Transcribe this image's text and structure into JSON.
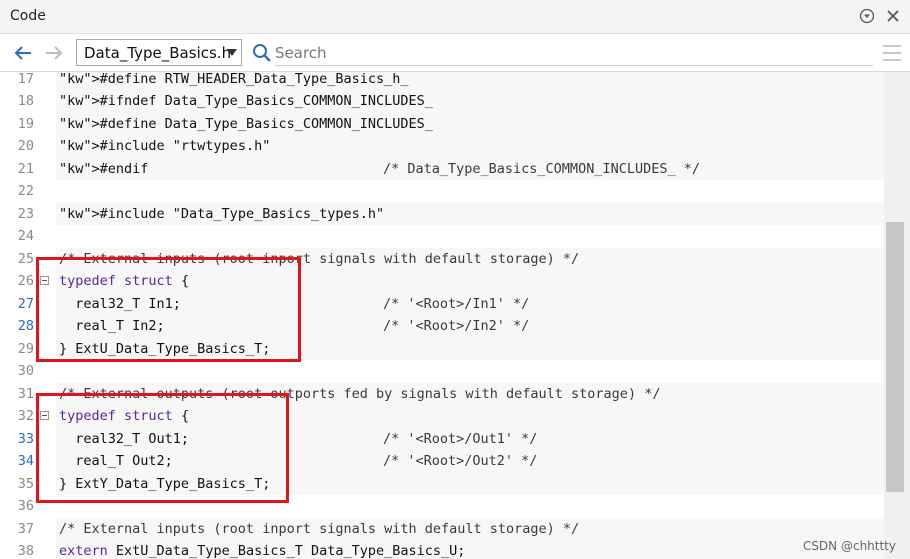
{
  "window": {
    "title": "Code"
  },
  "toolbar": {
    "file_name": "Data_Type_Basics.h",
    "search_placeholder": "Search"
  },
  "code_lines": [
    {
      "num": "17",
      "text": "#define RTW_HEADER_Data_Type_Basics_h_"
    },
    {
      "num": "18",
      "text": "#ifndef Data_Type_Basics_COMMON_INCLUDES_"
    },
    {
      "num": "19",
      "text": "#define Data_Type_Basics_COMMON_INCLUDES_"
    },
    {
      "num": "20",
      "text": "#include \"rtwtypes.h\""
    },
    {
      "num": "21",
      "text": "#endif",
      "comment": "/* Data_Type_Basics_COMMON_INCLUDES_ */"
    },
    {
      "num": "22",
      "text": ""
    },
    {
      "num": "23",
      "text": "#include \"Data_Type_Basics_types.h\""
    },
    {
      "num": "24",
      "text": ""
    },
    {
      "num": "25",
      "text": "/* External inputs (root inport signals with default storage) */"
    },
    {
      "num": "26",
      "text": "typedef struct {"
    },
    {
      "num": "27",
      "text": "  real32_T In1;",
      "comment": "/* '<Root>/In1' */"
    },
    {
      "num": "28",
      "text": "  real_T In2;",
      "comment": "/* '<Root>/In2' */"
    },
    {
      "num": "29",
      "text": "} ExtU_Data_Type_Basics_T;"
    },
    {
      "num": "30",
      "text": ""
    },
    {
      "num": "31",
      "text": "/* External outputs (root outports fed by signals with default storage) */"
    },
    {
      "num": "32",
      "text": "typedef struct {"
    },
    {
      "num": "33",
      "text": "  real32_T Out1;",
      "comment": "/* '<Root>/Out1' */"
    },
    {
      "num": "34",
      "text": "  real_T Out2;",
      "comment": "/* '<Root>/Out2' */"
    },
    {
      "num": "35",
      "text": "} ExtY_Data_Type_Basics_T;"
    },
    {
      "num": "36",
      "text": ""
    },
    {
      "num": "37",
      "text": "/* External inputs (root inport signals with default storage) */"
    },
    {
      "num": "38",
      "text": "extern ExtU_Data_Type_Basics_T Data_Type_Basics_U;"
    }
  ],
  "watermark": "CSDN @chhttty",
  "colors": {
    "highlight_box": "#e0141b",
    "keyword": "#7a1f1f",
    "typedef": "#5c2699",
    "link_line_number": "#2b6cc4"
  }
}
